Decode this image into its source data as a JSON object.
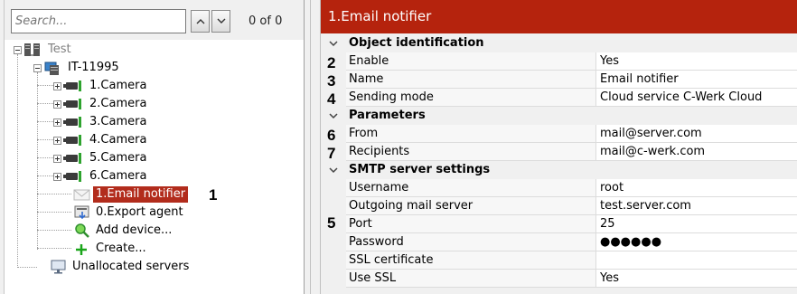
{
  "search": {
    "placeholder": "Search...",
    "value": "",
    "count": "0 of 0"
  },
  "tree": {
    "root": "Test",
    "server": "IT-11995",
    "cameras": [
      "1.Camera",
      "2.Camera",
      "3.Camera",
      "4.Camera",
      "5.Camera",
      "6.Camera"
    ],
    "email_notifier": "1.Email notifier",
    "export_agent": "0.Export agent",
    "add_device": "Add device...",
    "create": "Create...",
    "unallocated": "Unallocated servers"
  },
  "panel": {
    "title": "1.Email notifier",
    "categories": [
      {
        "title": "Object identification",
        "props": [
          {
            "name": "Enable",
            "value": "Yes"
          },
          {
            "name": "Name",
            "value": "Email notifier"
          },
          {
            "name": "Sending mode",
            "value": "Cloud service C-Werk Cloud"
          }
        ]
      },
      {
        "title": "Parameters",
        "props": [
          {
            "name": "From",
            "value": "mail@server.com"
          },
          {
            "name": "Recipients",
            "value": "mail@c-werk.com"
          }
        ]
      },
      {
        "title": "SMTP server settings",
        "props": [
          {
            "name": "Username",
            "value": "root"
          },
          {
            "name": "Outgoing mail server",
            "value": "test.server.com"
          },
          {
            "name": "Port",
            "value": "25"
          },
          {
            "name": "Password",
            "value": "●●●●●●"
          },
          {
            "name": "SSL certificate",
            "value": ""
          },
          {
            "name": "Use SSL",
            "value": "Yes"
          }
        ]
      }
    ]
  },
  "callouts": [
    "1",
    "2",
    "3",
    "4",
    "5",
    "6",
    "7"
  ],
  "colors": {
    "accent": "#b5230d",
    "selection": "#b22c1c",
    "camera_led": "#2ea32e"
  }
}
